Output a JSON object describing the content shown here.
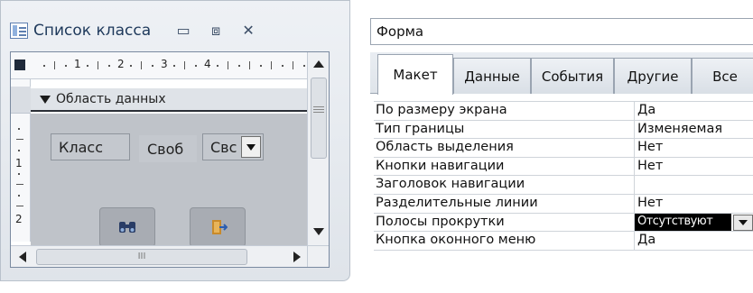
{
  "window": {
    "title": "Список класса",
    "buttons": {
      "minimize": "▭",
      "maximize": "⧈",
      "close": "✕"
    },
    "icon": "form-icon"
  },
  "design": {
    "ruler_numbers": [
      "1",
      "2",
      "3",
      "4"
    ],
    "left_ruler_numbers": [
      "1",
      "2"
    ],
    "section_label": "Область данных",
    "controls": {
      "label_class": "Класс",
      "field_free": "Своб",
      "combo_free": "Свс"
    },
    "buttons": {
      "binoculars_icon": "binoculars-icon",
      "exit_icon": "exit-door-icon"
    },
    "hscroll_grip": "III"
  },
  "props": {
    "object": "Форма",
    "tabs": [
      "Макет",
      "Данные",
      "События",
      "Другие",
      "Все"
    ],
    "active_tab": "Макет",
    "rows": [
      {
        "name": "По размеру экрана",
        "value": "Да"
      },
      {
        "name": "Тип границы",
        "value": "Изменяемая"
      },
      {
        "name": "Область выделения",
        "value": "Нет"
      },
      {
        "name": "Кнопки навигации",
        "value": "Нет"
      },
      {
        "name": "Заголовок навигации",
        "value": ""
      },
      {
        "name": "Разделительные линии",
        "value": "Нет"
      },
      {
        "name": "Полосы прокрутки",
        "value": "Отсутствуют"
      },
      {
        "name": "Кнопка оконного меню",
        "value": "Да"
      }
    ]
  },
  "colors": {
    "title_text": "#1e395b",
    "detail_bg": "#bfc3c9",
    "selected_value_bg": "#000000"
  }
}
